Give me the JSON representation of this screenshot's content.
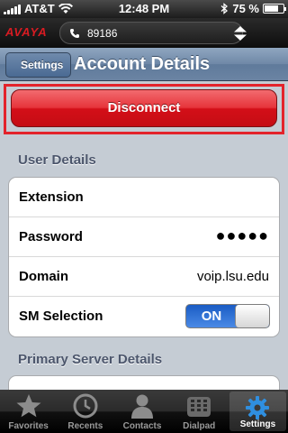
{
  "status_bar": {
    "carrier": "AT&T",
    "time": "12:48 PM",
    "battery": "75 %",
    "battery_level": 0.75
  },
  "app_bar": {
    "brand": "AVAYA",
    "line_number": "89186"
  },
  "nav": {
    "back_label": "Settings",
    "title": "Account Details"
  },
  "main": {
    "disconnect_label": "Disconnect",
    "user_details_title": "User Details",
    "rows": [
      {
        "label": "Extension",
        "value": ""
      },
      {
        "label": "Password",
        "value": "●●●●●"
      },
      {
        "label": "Domain",
        "value": "voip.lsu.edu"
      },
      {
        "label": "SM Selection",
        "value": "ON"
      }
    ],
    "primary_server_title": "Primary Server Details"
  },
  "tabs": [
    {
      "label": "Favorites",
      "icon": "star-icon",
      "active": false
    },
    {
      "label": "Recents",
      "icon": "clock-icon",
      "active": false
    },
    {
      "label": "Contacts",
      "icon": "person-icon",
      "active": false
    },
    {
      "label": "Dialpad",
      "icon": "dialpad-icon",
      "active": false
    },
    {
      "label": "Settings",
      "icon": "gear-icon",
      "active": true
    }
  ],
  "colors": {
    "brand_red": "#d81b22",
    "nav_blue": "#6f88a7",
    "toggle_blue": "#1a5cc4",
    "highlight_red": "#e3232b",
    "active_tab": "#2f8fe0"
  }
}
